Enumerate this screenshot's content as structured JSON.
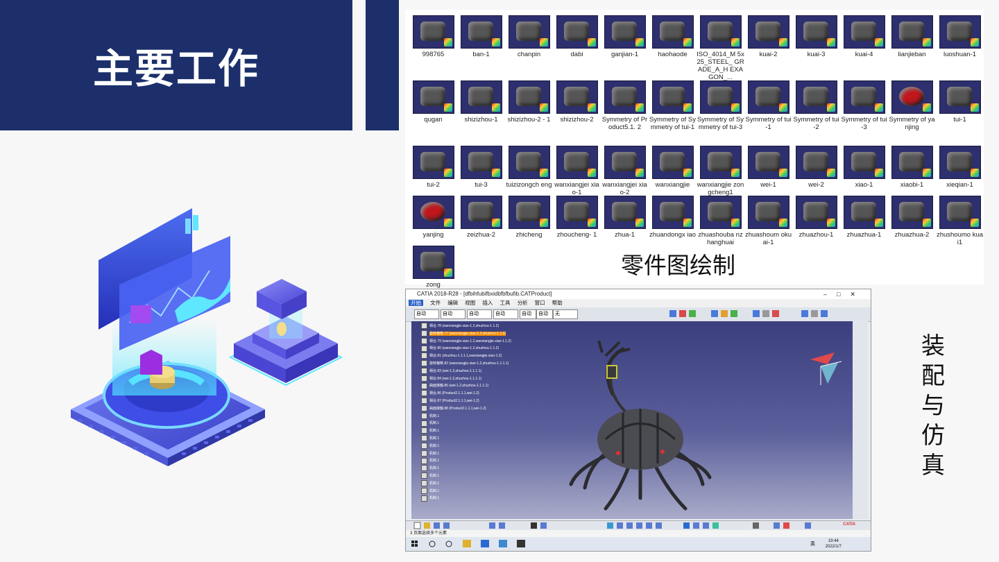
{
  "title": "主要工作",
  "parts": [
    {
      "label": "998765"
    },
    {
      "label": "ban-1"
    },
    {
      "label": "chanpin"
    },
    {
      "label": "dabi"
    },
    {
      "label": "ganjian-1"
    },
    {
      "label": "haohaode"
    },
    {
      "label": "ISO_4014_M 5x25_STEEL_ GRADE_A_H EXAGON_..."
    },
    {
      "label": "kuai-2"
    },
    {
      "label": "kuai-3"
    },
    {
      "label": "kuai-4"
    },
    {
      "label": "lianjieban"
    },
    {
      "label": "luoshuan-1"
    },
    {
      "label": "qugan"
    },
    {
      "label": "shizizhou-1"
    },
    {
      "label": "shizizhou-2 - 1"
    },
    {
      "label": "shizizhou-2"
    },
    {
      "label": "Symmetry of Product5.1. 2"
    },
    {
      "label": "Symmetry of Symmetry of tui-1"
    },
    {
      "label": "Symmetry of Symmetry of tui-3"
    },
    {
      "label": "Symmetry of tui-1"
    },
    {
      "label": "Symmetry of tui-2"
    },
    {
      "label": "Symmetry of tui-3"
    },
    {
      "label": "Symmetry of yanjing"
    },
    {
      "label": "tui-1"
    },
    {
      "label": "tui-2"
    },
    {
      "label": "tui-3"
    },
    {
      "label": "tuizizongch eng"
    },
    {
      "label": "wanxiangjei xiao-1"
    },
    {
      "label": "wanxiangjei xiao-2"
    },
    {
      "label": "wanxiangjie"
    },
    {
      "label": "wanxiangjie zongcheng1"
    },
    {
      "label": "wei-1"
    },
    {
      "label": "wei-2"
    },
    {
      "label": "xiao-1"
    },
    {
      "label": "xiaobi-1"
    },
    {
      "label": "xieqian-1"
    },
    {
      "label": "yanjing"
    },
    {
      "label": "zeizhua-2"
    },
    {
      "label": "zhicheng"
    },
    {
      "label": "zhoucheng- 1"
    },
    {
      "label": "zhua-1"
    },
    {
      "label": "zhuandongx iao"
    },
    {
      "label": "zhuashouba nzhanghuai"
    },
    {
      "label": "zhuashoum okuai-1"
    },
    {
      "label": "zhuazhou-1"
    },
    {
      "label": "zhuazhua-1"
    },
    {
      "label": "zhuazhua-2"
    },
    {
      "label": "zhushoumo kuai1"
    },
    {
      "label": "zong"
    }
  ],
  "parts_caption": "零件图绘制",
  "catia": {
    "title": "CATIA 2018-R28 - [dfbihfubifbxidbfbfbufib.CATProduct]",
    "menu": [
      "开始",
      "文件",
      "编辑",
      "视图",
      "插入",
      "工具",
      "分析",
      "窗口",
      "帮助"
    ],
    "selects": [
      "自动",
      "自动",
      "自动",
      "自动",
      "自动",
      "自动",
      "无"
    ],
    "tree": [
      "相合.78 (wanxiangjie.xiao-1.2,shuzhou-1.1.2)",
      "旋转偏移.77 (wanxiangjie.xiao-1.2,shuzhou-1.1.2)",
      "相合.79 (wanxiangjie.xiao-1.2,wanxiangjie.xiao-1.1.2)",
      "相合.80 (wanxiangjie.xiao-1.2,shuzhou-1.1.2)",
      "相合.81 (shuzhou-1.1.1.1,wanxiangjie.xiao-1.2)",
      "旋转偏移.82 (wanxiangjie.xiao-1.2,shuzhou-1.1.1.1)",
      "相合.83 (wei-1.2,shuzhou-1.1.1.1)",
      "相合.84 (wei-1.2,shuzhou-1.1.1.1)",
      "曲面接触.85 (wei-1.2,shuzhou-1.1.1.1)",
      "相合.86 (Product2.1.1.1,wei-1.2)",
      "相合.87 (Product2.1.1.1,wei-1.2)",
      "曲面接触.88 (Product2.1.1.1,wei-1.2)",
      "机制.1",
      "机制.1",
      "机制.1",
      "机制.1",
      "机制.1",
      "机制.1",
      "机制.1",
      "机制.1",
      "机制.1",
      "机制.1",
      "机制.1",
      "机制.1"
    ],
    "status": "3 页面选择多个元素",
    "clock_time": "19:44",
    "clock_date": "2022/1/7",
    "tray_lang": "英",
    "brand": "CATIA"
  },
  "assembly_caption": [
    "装",
    "配",
    "与",
    "仿",
    "真"
  ]
}
